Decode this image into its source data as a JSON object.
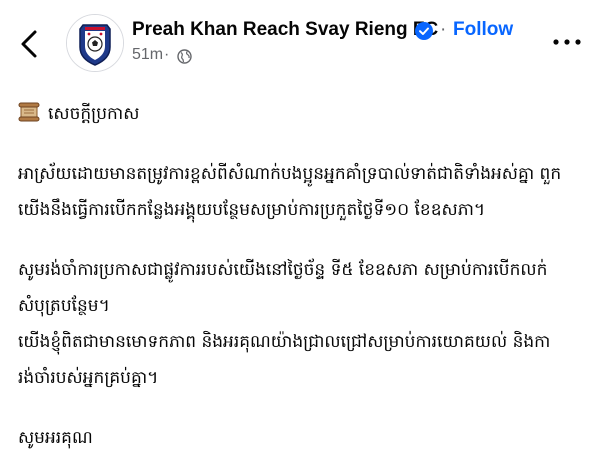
{
  "header": {
    "back_icon": "chevron-left-icon",
    "page_name": "Preah Khan Reach Svay Rieng FC",
    "verified_icon": "verified-badge-icon",
    "separator": "·",
    "follow_label": "Follow",
    "time": "51m",
    "time_separator": "·",
    "audience_icon": "globe-icon",
    "more_icon": "more-options-icon"
  },
  "post": {
    "title_emoji": "scroll-icon",
    "title": "សេចក្ដីប្រកាស",
    "paragraph1": [
      "អាស្រ័យដោយមានតម្រូវការខ្ពស់ពីសំណាក់បងប្អូនអ្នកគាំទ្របាល់ទាត់ជាតិទាំងអស់គ្នា ពួក",
      "យើងនឹងធ្វើការបើកកន្លែងអង្គុយបន្ថែមសម្រាប់ការប្រកួតថ្ងៃទី១០ ខែឧសភា។"
    ],
    "paragraph2": [
      "សូមរង់ចាំការប្រកាសជាផ្លូវការរបស់យើងនៅថ្ងៃច័ន្ទ ទី៥ ខែឧសភា សម្រាប់ការបើកលក់",
      "សំបុត្របន្ថែម។",
      "យើងខ្ញុំពិតជាមានមោទកភាព និងអរគុណយ៉ាងជ្រាលជ្រៅសម្រាប់ការយោគយល់ និងកា",
      "រង់ចាំរបស់អ្នកគ្រប់គ្នា។"
    ],
    "closing": "សូមអរគុណ"
  },
  "colors": {
    "link": "#0866ff",
    "secondary_text": "#65676b",
    "primary_text": "#050505"
  }
}
